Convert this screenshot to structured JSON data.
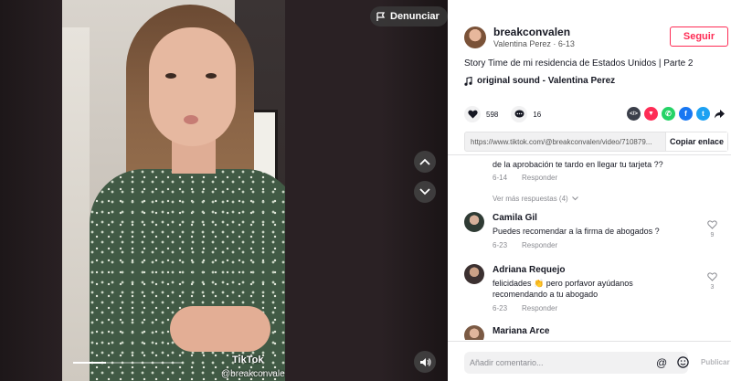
{
  "video": {
    "report_label": "Denunciar",
    "watermark_brand": "TikTok",
    "watermark_user": "@breakconvalen",
    "progress": 0.3
  },
  "author": {
    "username": "breakconvalen",
    "subline": "Valentina Perez · 6-13",
    "follow_label": "Seguir"
  },
  "post": {
    "caption": "Story Time de mi residencia de Estados Unidos | Parte 2",
    "sound": "original sound - Valentina Perez",
    "likes": "598",
    "comments": "16",
    "link": "https://www.tiktok.com/@breakconvalen/video/710879...",
    "copy_label": "Copiar enlace"
  },
  "share_icons": [
    {
      "name": "embed-icon",
      "color": "#3b3f4a",
      "glyph": "</>"
    },
    {
      "name": "send-friends-icon",
      "color": "#fe2c55",
      "glyph": "▼"
    },
    {
      "name": "whatsapp-icon",
      "color": "#25d366",
      "glyph": "✆"
    },
    {
      "name": "facebook-icon",
      "color": "#1877f2",
      "glyph": "f"
    },
    {
      "name": "twitter-icon",
      "color": "#1da1f2",
      "glyph": "t"
    }
  ],
  "comments": {
    "partial": {
      "text": "de la aprobación te tardo en llegar tu tarjeta ??",
      "date": "6-14",
      "reply_label": "Responder"
    },
    "more_replies": "Ver más respuestas (4)",
    "items": [
      {
        "name": "Camila Gil",
        "text": "Puedes recomendar a la firma de abogados ?",
        "date": "6-23",
        "reply_label": "Responder",
        "likes": "9"
      },
      {
        "name": "Adriana Requejo",
        "text": "felicidades 👏 pero porfavor ayúdanos recomendando a tu abogado",
        "date": "6-23",
        "reply_label": "Responder",
        "likes": "3"
      },
      {
        "name": "Mariana Arce",
        "text": "",
        "date": "",
        "reply_label": "",
        "likes": ""
      }
    ]
  },
  "composer": {
    "placeholder": "Añadir comentario...",
    "post_label": "Publicar"
  },
  "colors": {
    "accent": "#fe2c55",
    "text": "#161823",
    "muted": "#8a8b91"
  }
}
